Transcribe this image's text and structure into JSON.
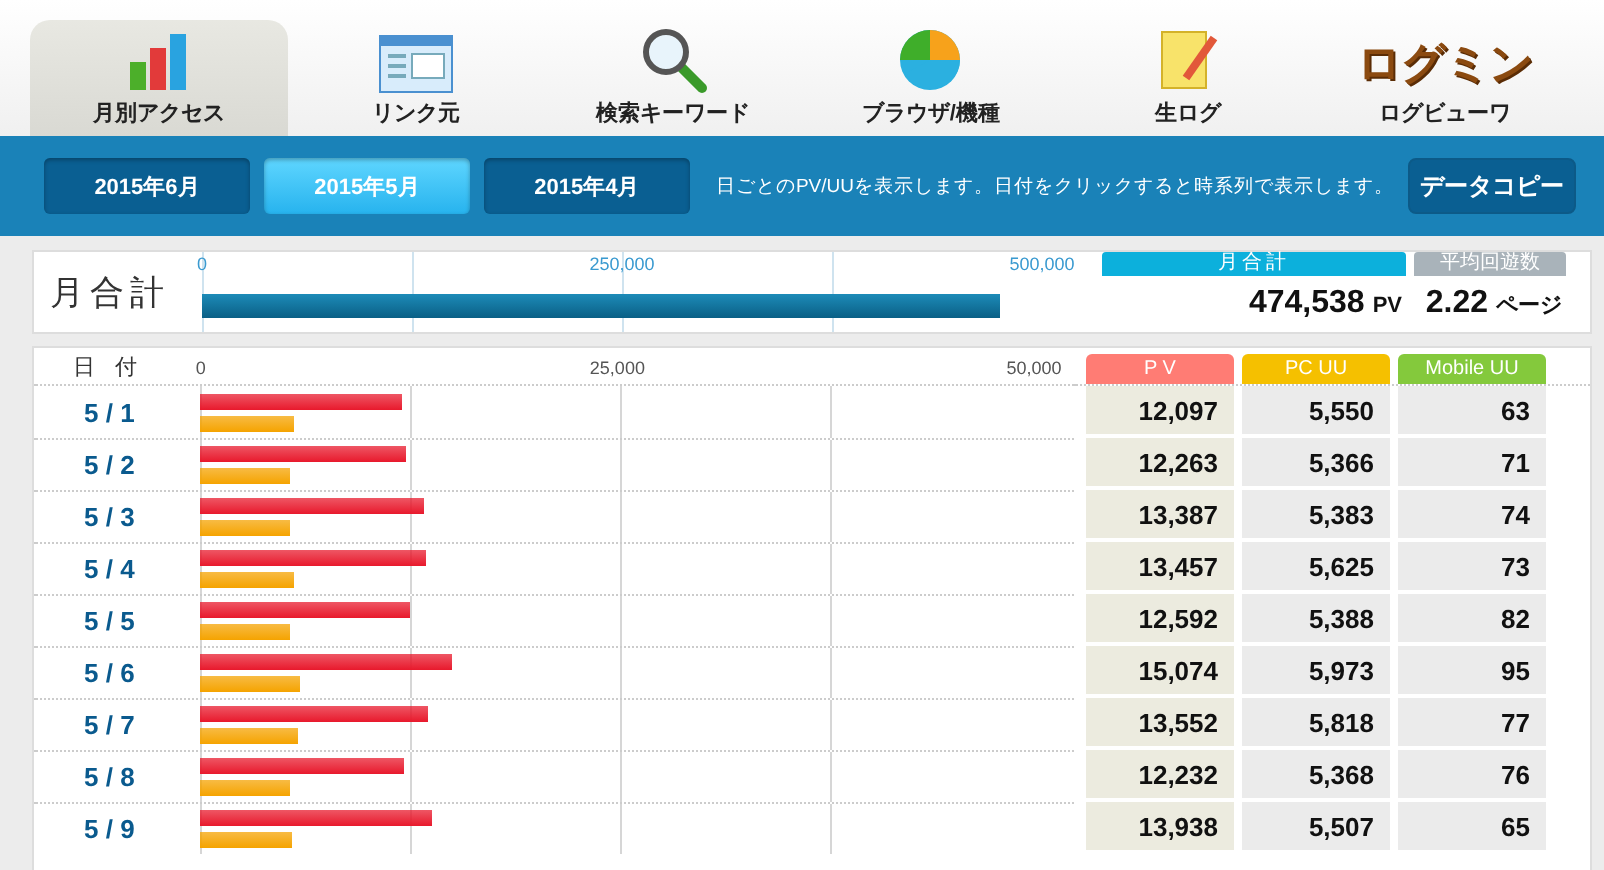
{
  "nav": {
    "tabs": [
      {
        "label": "月別アクセス",
        "selected": true
      },
      {
        "label": "リンク元",
        "selected": false
      },
      {
        "label": "検索キーワード",
        "selected": false
      },
      {
        "label": "ブラウザ/機種",
        "selected": false
      },
      {
        "label": "生ログ",
        "selected": false
      },
      {
        "label": "ログビューワ",
        "selected": false,
        "logo": "ログミン"
      }
    ]
  },
  "month_bar": {
    "months": [
      {
        "label": "2015年6月",
        "selected": false
      },
      {
        "label": "2015年5月",
        "selected": true
      },
      {
        "label": "2015年4月",
        "selected": false
      }
    ],
    "description": "日ごとのPV/UUを表示します。日付をクリックすると時系列で表示します。",
    "copy_button": "データコピー"
  },
  "monthly": {
    "chart_data": {
      "type": "bar",
      "orientation": "horizontal",
      "categories": [
        "月合計"
      ],
      "values": [
        475000
      ],
      "xlim": [
        0,
        500000
      ],
      "xticks": [
        {
          "value": 0,
          "label": "0"
        },
        {
          "value": 250000,
          "label": "250,000"
        },
        {
          "value": 500000,
          "label": "500,000"
        }
      ]
    },
    "total": {
      "header": "月合計",
      "value": "474,538",
      "unit": "PV"
    },
    "average": {
      "header": "平均回遊数",
      "value": "2.22",
      "unit": "ページ"
    }
  },
  "daily": {
    "date_header": "日付",
    "columns": [
      "P V",
      "PC UU",
      "Mobile UU"
    ],
    "chart_data": {
      "type": "bar",
      "orientation": "horizontal",
      "stacked": false,
      "categories": [
        "5 / 1",
        "5 / 2",
        "5 / 3",
        "5 / 4",
        "5 / 5",
        "5 / 6",
        "5 / 7",
        "5 / 8",
        "5 / 9"
      ],
      "series": [
        {
          "color": "#e8192c",
          "values": [
            12100,
            12300,
            13400,
            13500,
            12600,
            15100,
            13600,
            12200,
            13900
          ]
        },
        {
          "color": "#f5a300",
          "values": [
            5600,
            5400,
            5400,
            5600,
            5400,
            6000,
            5800,
            5400,
            5500
          ]
        }
      ],
      "xlim": [
        0,
        50000
      ],
      "xticks": [
        {
          "value": 0,
          "label": "0"
        },
        {
          "value": 25000,
          "label": "25,000"
        },
        {
          "value": 50000,
          "label": "50,000"
        }
      ]
    },
    "rows": [
      {
        "pv": "12,097",
        "pc_uu": "5,550",
        "mobile_uu": "63"
      },
      {
        "pv": "12,263",
        "pc_uu": "5,366",
        "mobile_uu": "71"
      },
      {
        "pv": "13,387",
        "pc_uu": "5,383",
        "mobile_uu": "74"
      },
      {
        "pv": "13,457",
        "pc_uu": "5,625",
        "mobile_uu": "73"
      },
      {
        "pv": "12,592",
        "pc_uu": "5,388",
        "mobile_uu": "82"
      },
      {
        "pv": "15,074",
        "pc_uu": "5,973",
        "mobile_uu": "95"
      },
      {
        "pv": "13,552",
        "pc_uu": "5,818",
        "mobile_uu": "77"
      },
      {
        "pv": "12,232",
        "pc_uu": "5,368",
        "mobile_uu": "76"
      },
      {
        "pv": "13,938",
        "pc_uu": "5,507",
        "mobile_uu": "65"
      }
    ]
  }
}
